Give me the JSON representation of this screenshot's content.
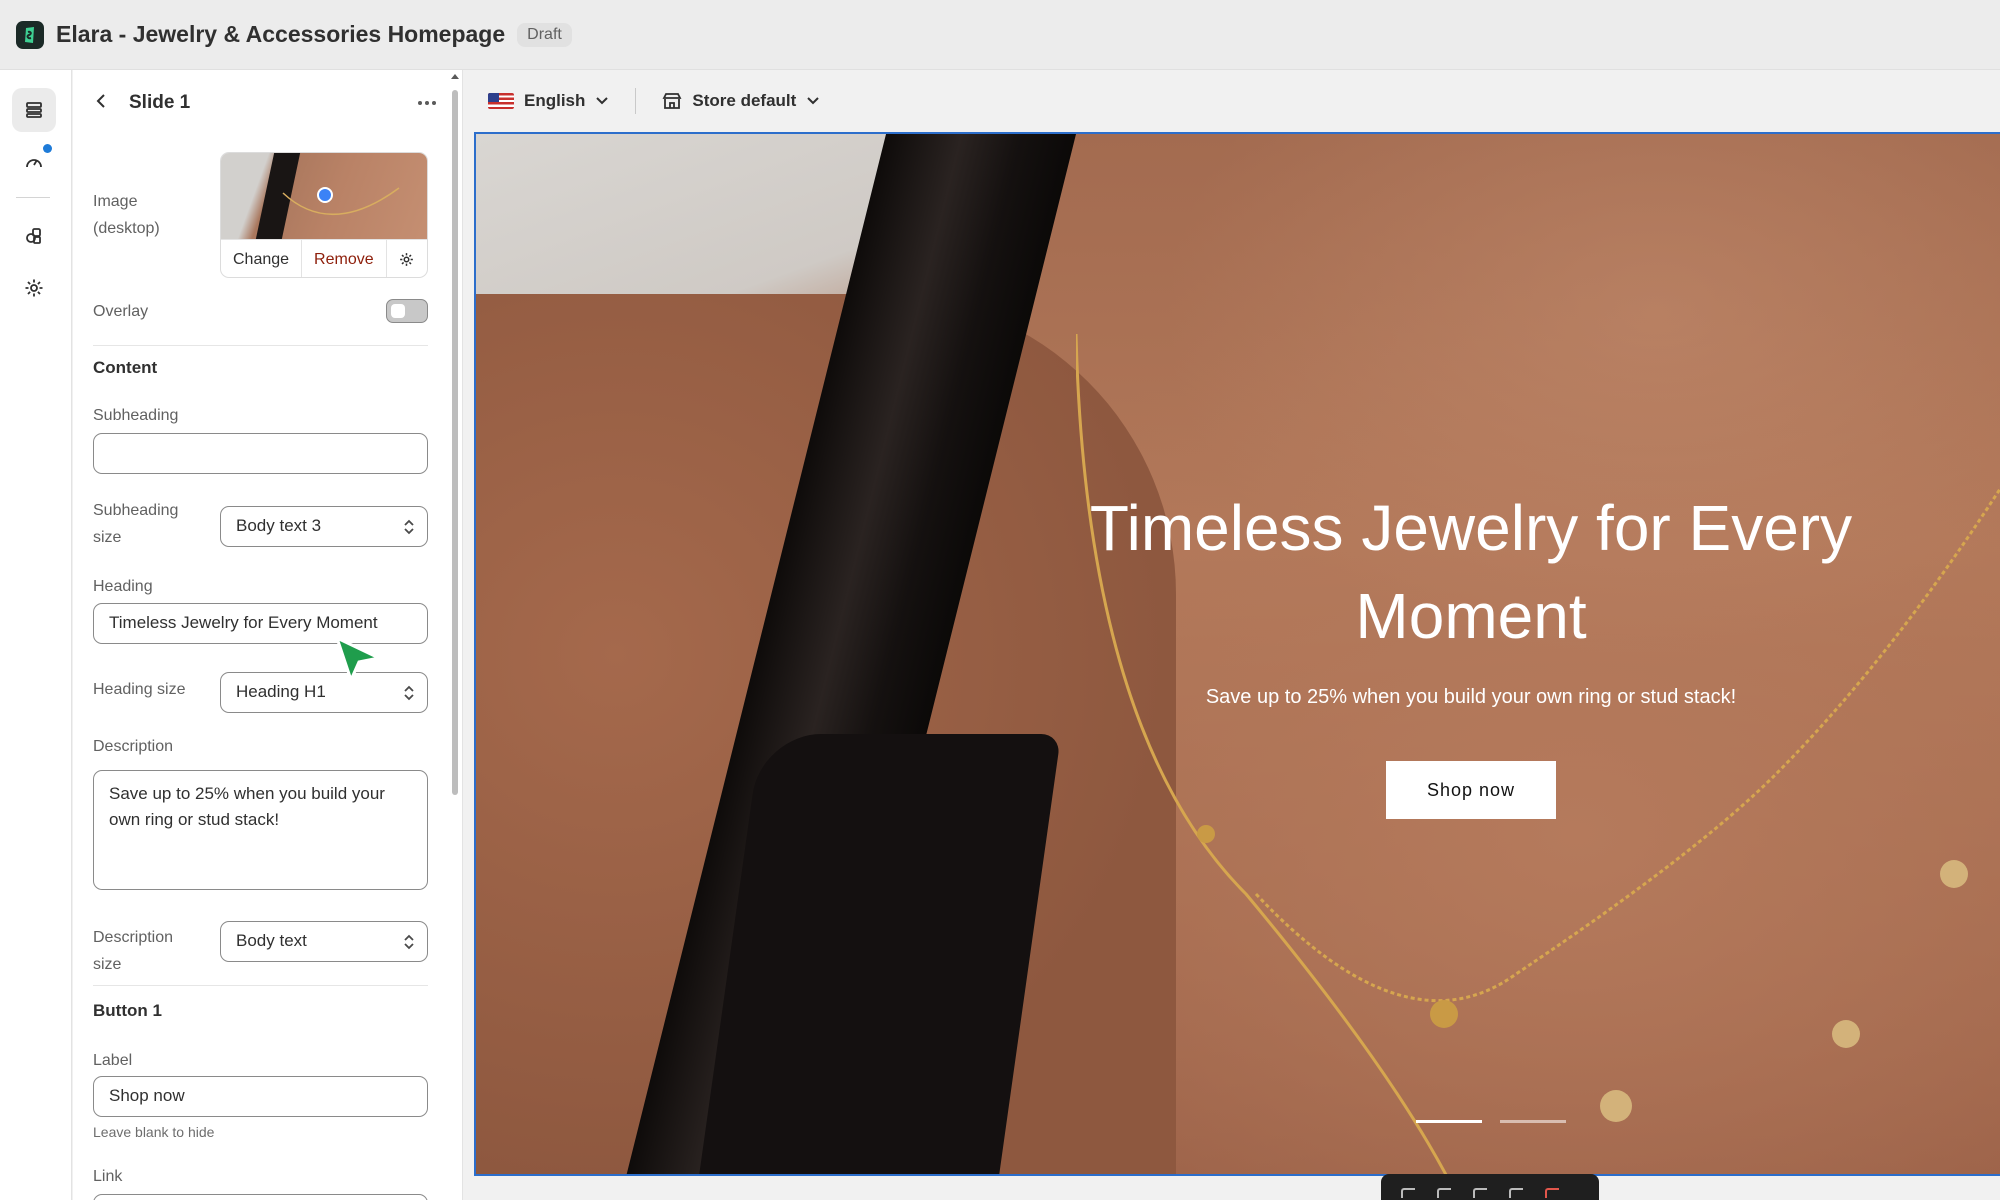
{
  "app": {
    "title": "Elara - Jewelry & Accessories Homepage",
    "badge": "Draft"
  },
  "rail": {
    "icons": [
      "sections-icon",
      "speed-icon",
      "apps-icon",
      "settings-icon"
    ]
  },
  "panel": {
    "title": "Slide 1",
    "image": {
      "label": "Image (desktop)",
      "change": "Change",
      "remove": "Remove"
    },
    "overlay": {
      "label": "Overlay",
      "on": false
    },
    "content": {
      "title": "Content",
      "subheading_label": "Subheading",
      "subheading_value": "",
      "subheading_size_label": "Subheading size",
      "subheading_size_value": "Body text 3",
      "heading_label": "Heading",
      "heading_value": "Timeless Jewelry for Every Moment",
      "heading_size_label": "Heading size",
      "heading_size_value": "Heading H1",
      "description_label": "Description",
      "description_value": "Save up to 25% when you build your own ring or stud stack!",
      "description_size_label": "Description size",
      "description_size_value": "Body text"
    },
    "button1": {
      "title": "Button 1",
      "label_label": "Label",
      "label_value": "Shop now",
      "hint": "Leave blank to hide",
      "link_label": "Link"
    }
  },
  "preview_bar": {
    "language": "English",
    "store": "Store default"
  },
  "hero": {
    "heading": "Timeless Jewelry for Every Moment",
    "description": "Save up to 25% when you build your own ring or stud stack!",
    "button": "Shop now",
    "slides": 2,
    "active_slide": 1
  },
  "colors": {
    "accent": "#2c6ecb",
    "remove": "#8e1f0b",
    "notification": "#1e7bd8"
  }
}
